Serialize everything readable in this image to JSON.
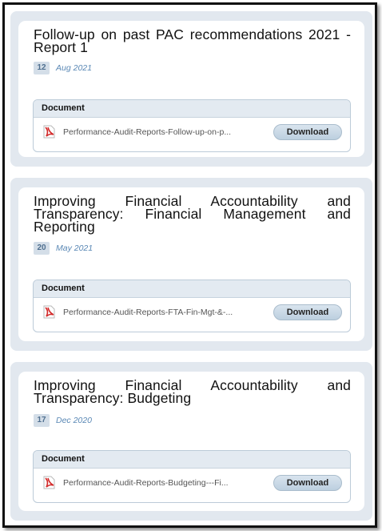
{
  "cards": [
    {
      "title": "Follow-up on past PAC recommendations 2021 - Report 1",
      "day": "12",
      "month_year": "Aug 2021",
      "doc_header": "Document",
      "file_name": "Performance-Audit-Reports-Follow-up-on-p...",
      "download_label": "Download"
    },
    {
      "title": "Improving Financial Accountability and Transparency: Financial Management and Reporting",
      "day": "20",
      "month_year": "May 2021",
      "doc_header": "Document",
      "file_name": "Performance-Audit-Reports-FTA-Fin-Mgt-&-...",
      "download_label": "Download"
    },
    {
      "title": "Improving Financial Accountability and Transparency: Budgeting",
      "day": "17",
      "month_year": "Dec 2020",
      "doc_header": "Document",
      "file_name": "Performance-Audit-Reports-Budgeting---Fi...",
      "download_label": "Download"
    }
  ],
  "icons": {
    "file": "pdf-file-icon"
  },
  "colors": {
    "card_bg": "#e2e8ef",
    "button": "#c6d6e4",
    "date_text": "#5a88b5",
    "pdf_red": "#d22a2a"
  }
}
